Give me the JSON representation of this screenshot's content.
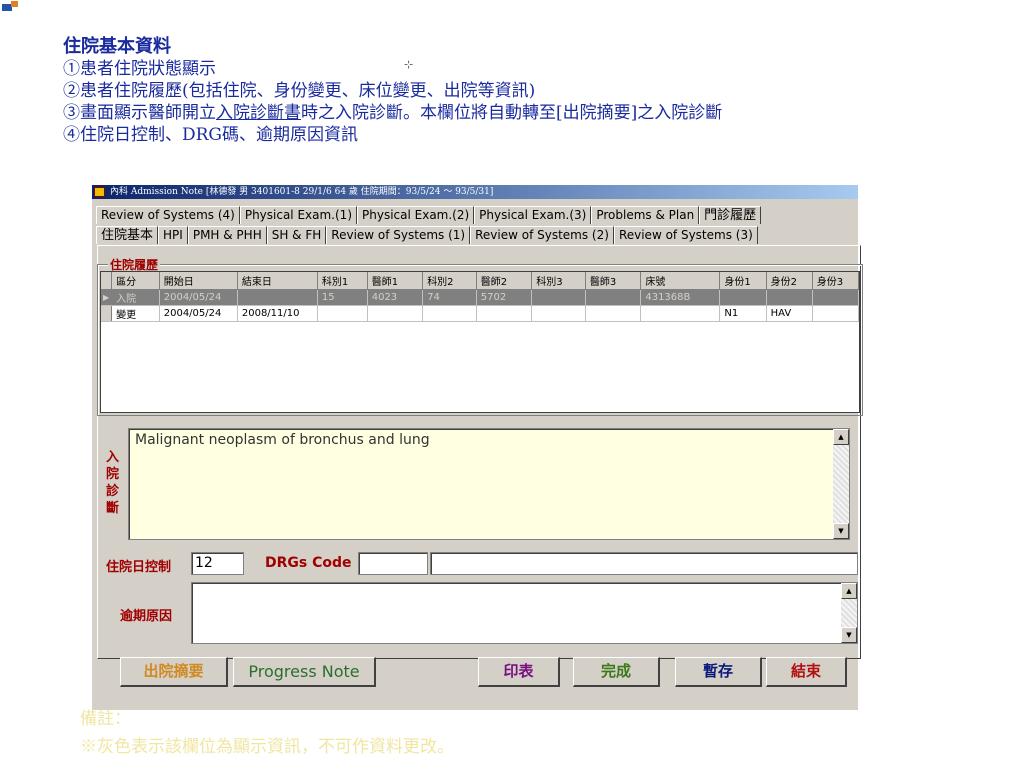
{
  "intro": {
    "title": "住院基本資料",
    "line1": "①患者住院狀態顯示",
    "line2": "②患者住院履歷(包括住院、身份變更、床位變更、出院等資訊)",
    "line3_pre": "③畫面顯示醫師開立",
    "line3_u": "入院診斷書",
    "line3_post": "時之入院診斷。本欄位將自動轉至[出院摘要]之入院診斷",
    "line4": "④住院日控制、DRG碼、逾期原因資訊"
  },
  "window": {
    "title": "內科 Admission Note [林德發  男  3401601-8  29/1/6  64 歲  住院期間：93/5/24 ～ 93/5/31]"
  },
  "tabs_row1": [
    "Review of Systems (4)",
    "Physical Exam.(1)",
    "Physical Exam.(2)",
    "Physical Exam.(3)",
    "Problems & Plan",
    "門診履歷"
  ],
  "tabs_row2": [
    "住院基本",
    "HPI",
    "PMH & PHH",
    "SH & FH",
    "Review of Systems (1)",
    "Review of Systems (2)",
    "Review of Systems (3)"
  ],
  "history": {
    "label": "住院履歷",
    "columns": [
      "區分",
      "開始日",
      "結束日",
      "科別1",
      "醫師1",
      "科別2",
      "醫師2",
      "科別3",
      "醫師3",
      "床號",
      "身份1",
      "身份2",
      "身份3"
    ],
    "rows": [
      [
        "入院",
        "2004/05/24",
        "",
        "15",
        "4023",
        "74",
        "5702",
        "",
        "",
        "431368B",
        "",
        "",
        ""
      ],
      [
        "變更",
        "2004/05/24",
        "2008/11/10",
        "",
        "",
        "",
        "",
        "",
        "",
        "",
        "N1",
        "HAV",
        ""
      ]
    ]
  },
  "diagnosis": {
    "label": "入院診斷",
    "text": "Malignant neoplasm of bronchus and lung"
  },
  "control": {
    "days_label": "住院日控制",
    "days_value": "12",
    "drg_label": "DRGs Code",
    "overdue_label": "逾期原因"
  },
  "buttons": {
    "discharge": "出院摘要",
    "progress": "Progress Note",
    "print": "印表",
    "done": "完成",
    "save_temp": "暫存",
    "close": "結束"
  },
  "colors": {
    "label_red": "#a00000",
    "intro_blue": "#1a2b9e",
    "btn_discharge": "#d08a20",
    "btn_progress": "#2b6e2b",
    "btn_print": "#7a1080",
    "btn_done": "#3a7a1a",
    "btn_save": "#0a1a7a",
    "btn_close": "#b01010"
  },
  "note": {
    "title": "備註：",
    "text": "※灰色表示該欄位為顯示資訊，不可作資料更改。"
  }
}
